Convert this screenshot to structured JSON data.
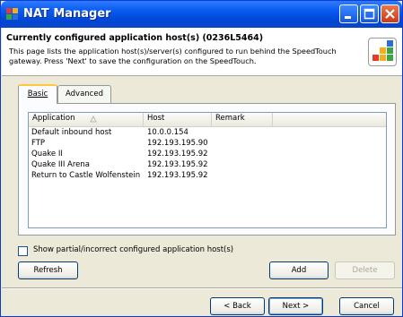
{
  "window": {
    "title": "NAT Manager",
    "title_bar_color": "#0a5cf0",
    "buttons": [
      "minimize",
      "maximize",
      "close"
    ]
  },
  "header": {
    "title": "Currently configured application host(s) (0236L5464)",
    "description": "This page lists the application host(s)/server(s) configured to run behind the SpeedTouch gateway. Press 'Next' to save the configuration on the SpeedTouch.",
    "logo_icon": "speedtouch-logo-icon"
  },
  "tabs": [
    {
      "label": "Basic",
      "active": true
    },
    {
      "label": "Advanced",
      "active": false
    }
  ],
  "listview": {
    "columns": [
      "Application",
      "Host",
      "Remark"
    ],
    "sort_icon": "sort-arrow-icon",
    "rows": [
      {
        "application": "Default inbound host",
        "host": "10.0.0.154",
        "remark": ""
      },
      {
        "application": "FTP",
        "host": "192.193.195.90",
        "remark": ""
      },
      {
        "application": "Quake II",
        "host": "192.193.195.92",
        "remark": ""
      },
      {
        "application": "Quake III Arena",
        "host": "192.193.195.92",
        "remark": ""
      },
      {
        "application": "Return to Castle Wolfenstein",
        "host": "192.193.195.92",
        "remark": ""
      }
    ]
  },
  "checkbox": {
    "label": "Show partial/incorrect configured application host(s)",
    "checked": false
  },
  "buttons": {
    "refresh": "Refresh",
    "add": "Add",
    "delete": "Delete",
    "back": "< Back",
    "next": "Next >",
    "cancel": "Cancel"
  }
}
